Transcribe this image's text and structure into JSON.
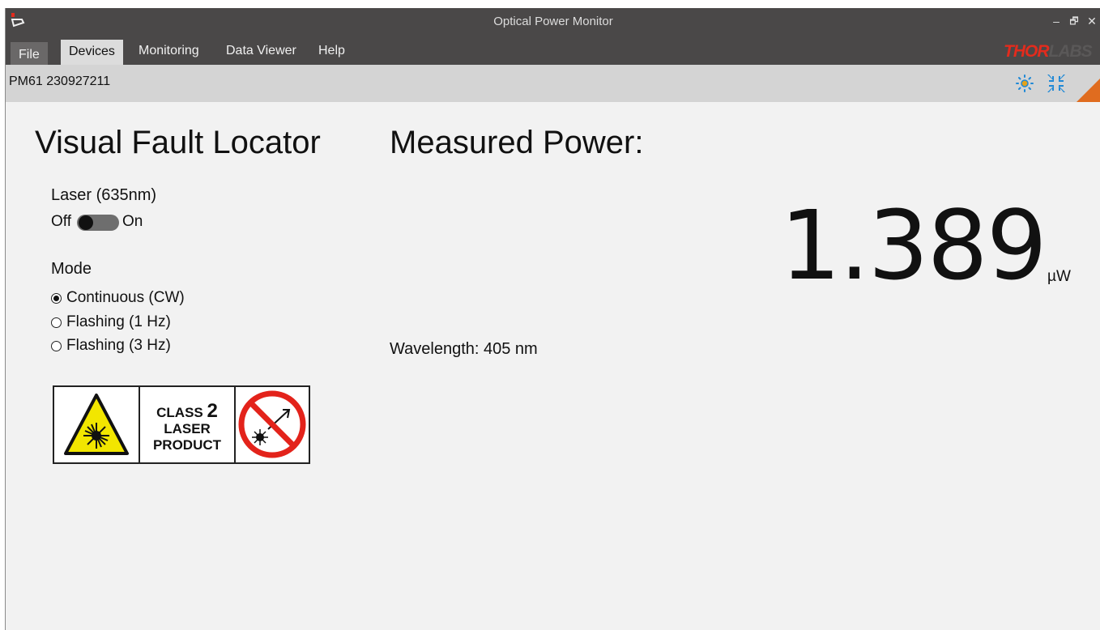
{
  "window": {
    "title": "Optical Power Monitor",
    "minimize_glyph": "–",
    "restore_glyph": "🗗",
    "close_glyph": "✕"
  },
  "menu": {
    "items": [
      {
        "label": "File"
      },
      {
        "label": "Devices"
      },
      {
        "label": "Monitoring"
      },
      {
        "label": "Data Viewer"
      },
      {
        "label": "Help"
      }
    ],
    "active": "Devices"
  },
  "brand": {
    "logo_text_red": "THOR",
    "logo_text_gray": "LABS"
  },
  "device_bar": {
    "device_id": "PM61 230927211",
    "icons": [
      "brightness-icon",
      "collapse-icon"
    ]
  },
  "vfl": {
    "heading": "Visual Fault Locator",
    "laser_label": "Laser (635nm)",
    "toggle_off": "Off",
    "toggle_on": "On",
    "toggle_state": "off",
    "mode_label": "Mode",
    "modes": [
      {
        "label": "Continuous (CW)",
        "selected": true
      },
      {
        "label": "Flashing (1 Hz)",
        "selected": false
      },
      {
        "label": "Flashing (3 Hz)",
        "selected": false
      }
    ],
    "laser_class": {
      "class_word": "CLASS",
      "class_num": "2",
      "line2": "LASER",
      "line3": "PRODUCT"
    }
  },
  "measurement": {
    "heading": "Measured Power:",
    "value": "1.389",
    "unit": "µW",
    "wavelength_label": "Wavelength:",
    "wavelength_value": "405 nm"
  },
  "colors": {
    "titlebar": "#4a4848",
    "device_bar": "#d4d4d4",
    "background": "#f2f2f2",
    "accent_orange": "#e06c1f",
    "brand_red": "#e32b1d",
    "icon_blue": "#1e88d6"
  }
}
